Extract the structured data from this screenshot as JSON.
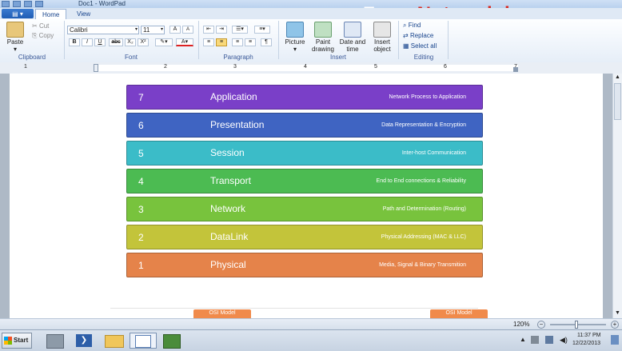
{
  "window": {
    "title": "Doc1 - WordPad"
  },
  "watermark": {
    "part1": "Faraz",
    "part2": "Network",
    "part3": ".ir"
  },
  "tabs": [
    {
      "label": "Home"
    },
    {
      "label": "View"
    }
  ],
  "ribbon": {
    "clipboard": {
      "paste": "Paste",
      "cut": "Cut",
      "copy": "Copy",
      "label": "Clipboard"
    },
    "font": {
      "family": "Calibri",
      "size": "11",
      "label": "Font",
      "bold": "B",
      "italic": "I",
      "underline": "U",
      "strike": "abc",
      "subscript": "X₂",
      "superscript": "X²",
      "grow": "A",
      "shrink": "A",
      "color": "A"
    },
    "paragraph": {
      "label": "Paragraph"
    },
    "insert": {
      "picture": "Picture",
      "paint_drawing": "Paint drawing",
      "date_time": "Date and time",
      "insert_object": "Insert object",
      "label": "Insert"
    },
    "editing": {
      "find": "Find",
      "replace": "Replace",
      "select_all": "Select all",
      "label": "Editing"
    }
  },
  "ruler": {
    "ticks": [
      "1",
      "1",
      "2",
      "3",
      "4",
      "5",
      "6",
      "7"
    ]
  },
  "osi_layers": [
    {
      "num": "7",
      "name": "Application",
      "desc": "Network Process to Application",
      "color": "#7a3fc8"
    },
    {
      "num": "6",
      "name": "Presentation",
      "desc": "Data Representation & Encryption",
      "color": "#3f64c2"
    },
    {
      "num": "5",
      "name": "Session",
      "desc": "Inter-host Communication",
      "color": "#3bbcc8"
    },
    {
      "num": "4",
      "name": "Transport",
      "desc": "End to End connections & Reliability",
      "color": "#4cbb52"
    },
    {
      "num": "3",
      "name": "Network",
      "desc": "Path and Determination (Routing)",
      "color": "#78c33d"
    },
    {
      "num": "2",
      "name": "DataLink",
      "desc": "Physical Addressing (MAC & LLC)",
      "color": "#c3c43a"
    },
    {
      "num": "1",
      "name": "Physical",
      "desc": "Media, Signal & Binary Transmition",
      "color": "#e5834a"
    }
  ],
  "osi_tabs": [
    "OSI Model",
    "OSI Model"
  ],
  "status": {
    "zoom": "120%"
  },
  "taskbar": {
    "start": "Start"
  },
  "clock": {
    "time": "11:37 PM",
    "date": "12/22/2013"
  }
}
